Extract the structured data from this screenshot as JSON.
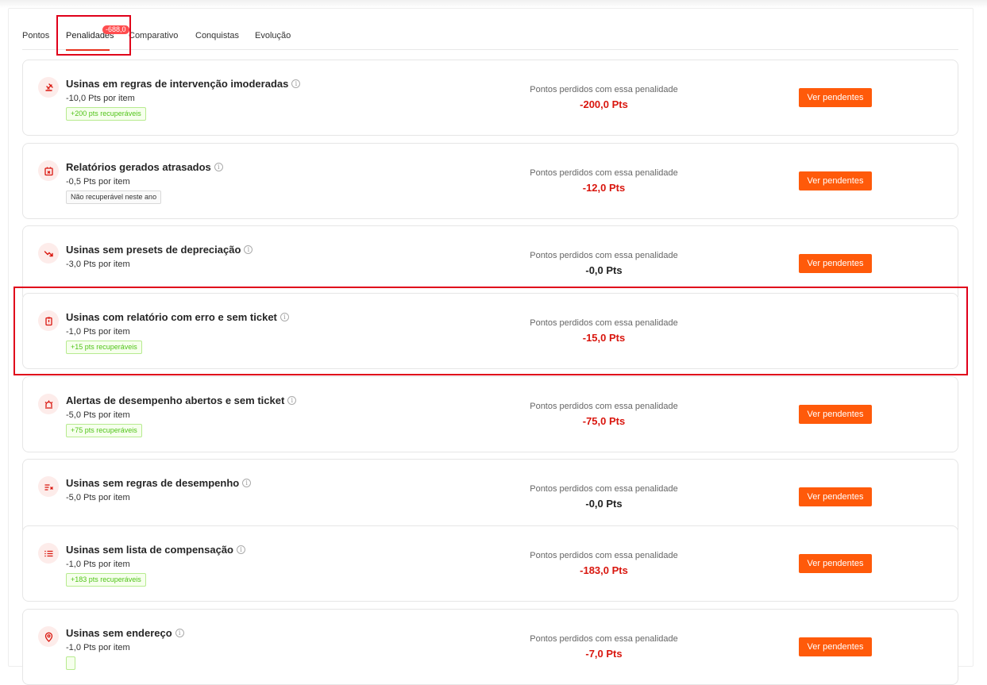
{
  "tabs": [
    {
      "label": "Pontos"
    },
    {
      "label": "Penalidades",
      "badge": "-688,0"
    },
    {
      "label": "Comparativo"
    },
    {
      "label": "Conquistas"
    },
    {
      "label": "Evolução"
    }
  ],
  "common": {
    "lost_label": "Pontos perdidos com essa penalidade",
    "button_label": "Ver pendentes"
  },
  "penalties": [
    {
      "icon": "gavel-icon",
      "title": "Usinas em regras de intervenção imoderadas",
      "per_item": "-10,0 Pts por item",
      "tag": "+200 pts recuperáveis",
      "tag_type": "green",
      "lost": "-200,0 Pts",
      "lost_color": "red",
      "has_button": true
    },
    {
      "icon": "calendar-x-icon",
      "title": "Relatórios gerados atrasados",
      "per_item": "-0,5 Pts por item",
      "tag": "Não recuperável neste ano",
      "tag_type": "gray",
      "lost": "-12,0 Pts",
      "lost_color": "red",
      "has_button": true
    },
    {
      "icon": "trend-down-icon",
      "title": "Usinas sem presets de depreciação",
      "per_item": "-3,0 Pts por item",
      "tag": "",
      "tag_type": "none",
      "lost": "-0,0 Pts",
      "lost_color": "black",
      "has_button": true
    },
    {
      "icon": "clipboard-alert-icon",
      "title": "Usinas com relatório com erro e sem ticket",
      "per_item": "-1,0 Pts por item",
      "tag": "+15 pts recuperáveis",
      "tag_type": "green",
      "lost": "-15,0 Pts",
      "lost_color": "red",
      "has_button": false
    },
    {
      "icon": "siren-icon",
      "title": "Alertas de desempenho abertos e sem ticket",
      "per_item": "-5,0 Pts por item",
      "tag": "+75 pts recuperáveis",
      "tag_type": "green",
      "lost": "-75,0 Pts",
      "lost_color": "red",
      "has_button": true
    },
    {
      "icon": "list-x-icon",
      "title": "Usinas sem regras de desempenho",
      "per_item": "-5,0 Pts por item",
      "tag": "",
      "tag_type": "none",
      "lost": "-0,0 Pts",
      "lost_color": "black",
      "has_button": true
    },
    {
      "icon": "list-icon",
      "title": "Usinas sem lista de compensação",
      "per_item": "-1,0 Pts por item",
      "tag": "+183 pts recuperáveis",
      "tag_type": "green",
      "lost": "-183,0 Pts",
      "lost_color": "red",
      "has_button": true
    },
    {
      "icon": "map-pin-icon",
      "title": "Usinas sem endereço",
      "per_item": "-1,0 Pts por item",
      "tag": "",
      "tag_type": "green",
      "lost": "-7,0 Pts",
      "lost_color": "red",
      "has_button": true
    }
  ],
  "colors": {
    "accent": "#ff5a0a",
    "loss_red": "#d9160e",
    "highlight": "#e0001a"
  }
}
